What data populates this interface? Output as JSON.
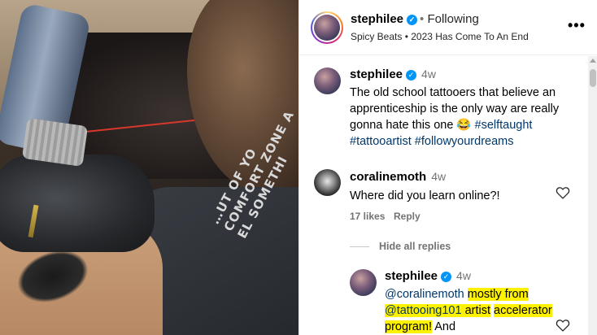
{
  "post": {
    "author": "stephilee",
    "separator": "•",
    "follow_status": "Following",
    "audio": "Spicy Beats • 2023 Has Come To An End",
    "more_icon": "more-horizontal-icon"
  },
  "media": {
    "shirt_text": "…UT OF YO\nCOMFORT ZONE A\nEL SOMETHI"
  },
  "caption": {
    "username": "stephilee",
    "time": "4w",
    "text": "The old school tattooers that believe an apprenticeship is the only way are really gonna hate this one",
    "emoji": "😂",
    "hashtags": [
      "#selftaught",
      "#tattooartist",
      "#followyourdreams"
    ]
  },
  "comments": [
    {
      "username": "coralinemoth",
      "time": "4w",
      "text": "Where did you learn online?!",
      "likes": "17 likes",
      "reply": "Reply",
      "hide_replies": "Hide all replies"
    }
  ],
  "replies": [
    {
      "username": "stephilee",
      "time": "4w",
      "mention": "@coralinemoth",
      "highlight1": "mostly from",
      "mention2": "@tattooing101",
      "highlight2": "artist",
      "highlight3": "accelerator program!",
      "trailing": "And"
    }
  ],
  "colors": {
    "verified": "#0095f6",
    "hashtag": "#00376b",
    "highlight": "#fff200",
    "muted": "#737373"
  }
}
